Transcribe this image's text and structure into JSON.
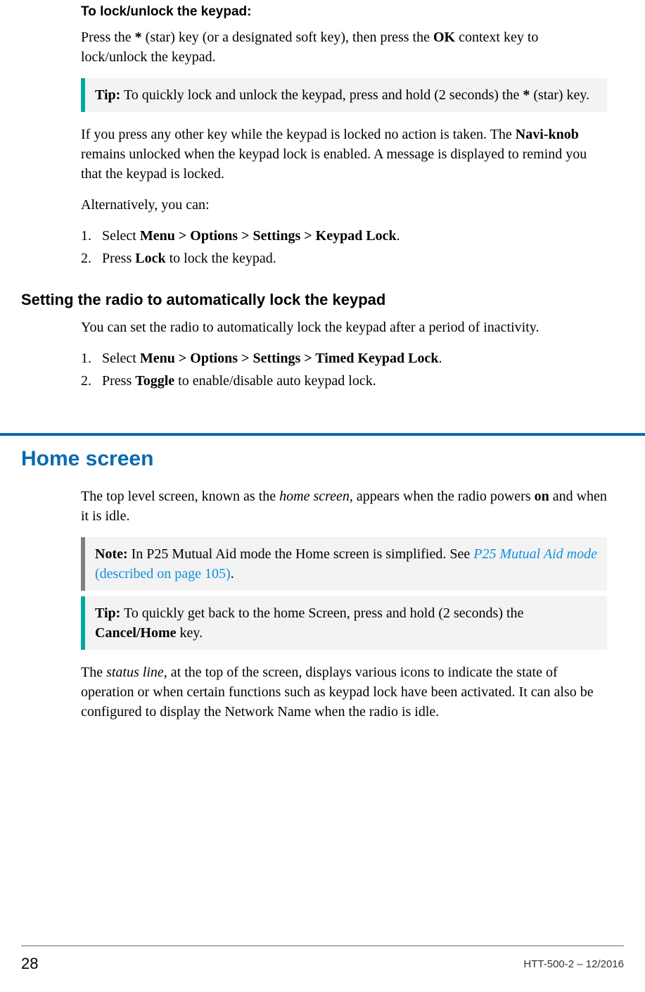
{
  "section1": {
    "heading": "To lock/unlock the keypad:",
    "p1_part1": "Press the ",
    "p1_bold1": "*",
    "p1_part2": " (star) key (or a designated soft key), then press the ",
    "p1_bold2": "OK",
    "p1_part3": " context key to lock/unlock the keypad.",
    "tip_label": "Tip:",
    "tip_part1": "  To quickly lock and unlock the keypad, press and hold (2 seconds) the ",
    "tip_bold": "*",
    "tip_part2": " (star) key.",
    "p2_part1": "If you press any other key while the keypad is locked no action is taken. The ",
    "p2_bold": "Navi-knob",
    "p2_part2": " remains unlocked when the keypad lock is enabled. A message is displayed to remind you that the keypad is locked.",
    "p3": "Alternatively, you can:",
    "li1_part1": "Select ",
    "li1_bold": "Menu > Options > Settings > Keypad Lock",
    "li1_part2": ".",
    "li2_part1": "Press ",
    "li2_bold": "Lock",
    "li2_part2": " to lock the keypad."
  },
  "section2": {
    "heading": "Setting the radio to automatically lock the keypad",
    "p1": "You can set the radio to automatically lock the keypad after a period of inactivity.",
    "li1_part1": "Select ",
    "li1_bold": "Menu > Options > Settings > Timed Keypad Lock",
    "li1_part2": ".",
    "li2_part1": "Press ",
    "li2_bold": "Toggle",
    "li2_part2": " to enable/disable auto keypad lock."
  },
  "section3": {
    "heading": "Home screen",
    "p1_part1": "The top level screen, known as the ",
    "p1_italic": "home screen",
    "p1_part2": ", appears when the radio powers ",
    "p1_bold": "on",
    "p1_part3": " and when it is idle.",
    "note_label": "Note:",
    "note_part1": "  In P25 Mutual Aid mode the Home screen is simplified. See ",
    "note_link1": "P25 Mutual Aid mode",
    "note_link2": " (described on page 105)",
    "note_part2": ".",
    "tip_label": "Tip:",
    "tip_part1": "  To quickly get back to the home Screen, press and hold (2 seconds) the ",
    "tip_bold": "Cancel/Home",
    "tip_part2": " key.",
    "p2_part1": "The ",
    "p2_italic": "status line,",
    "p2_part2": " at the top of the screen, displays various icons to indicate the state of operation or when certain functions such as keypad lock have been activated. It can also be configured to display the Network Name when the radio is idle."
  },
  "footer": {
    "page": "28",
    "doc_ref": "HTT-500-2 – 12/2016"
  }
}
